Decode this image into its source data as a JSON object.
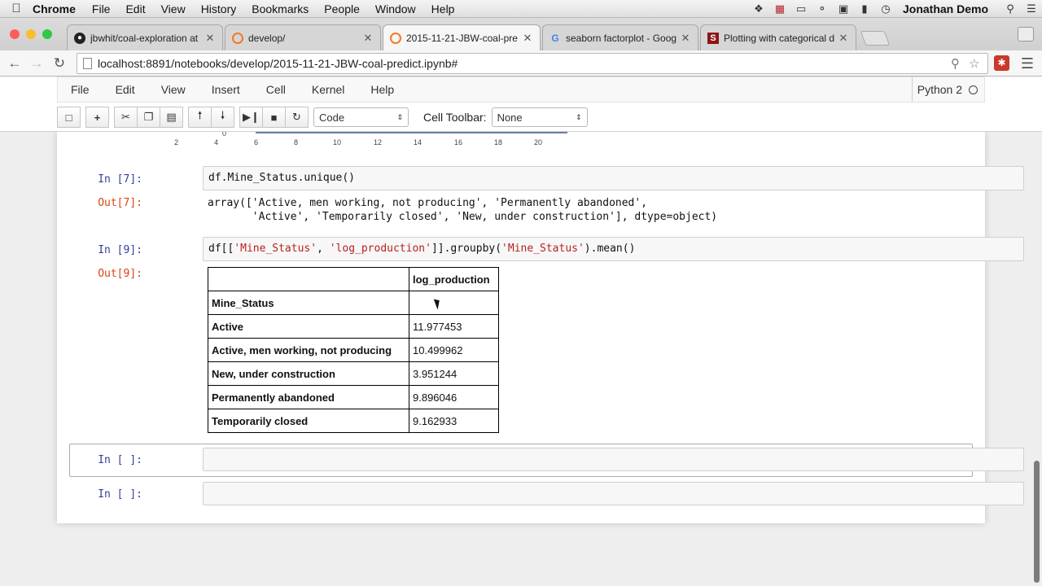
{
  "menubar": {
    "app": "Chrome",
    "items": [
      "File",
      "Edit",
      "View",
      "History",
      "Bookmarks",
      "People",
      "Window",
      "Help"
    ],
    "user": "Jonathan Demo"
  },
  "tabs": [
    {
      "title": "jbwhit/coal-exploration at",
      "icon": "github-icon"
    },
    {
      "title": "develop/",
      "icon": "jupyter-icon"
    },
    {
      "title": "2015-11-21-JBW-coal-pre",
      "icon": "jupyter-icon"
    },
    {
      "title": "seaborn factorplot - Goog",
      "icon": "google-icon"
    },
    {
      "title": "Plotting with categorical d",
      "icon": "stanford-icon"
    }
  ],
  "address_bar": {
    "url": "localhost:8891/notebooks/develop/2015-11-21-JBW-coal-predict.ipynb#"
  },
  "jupyter": {
    "menu": [
      "File",
      "Edit",
      "View",
      "Insert",
      "Cell",
      "Kernel",
      "Help"
    ],
    "kernel": "Python 2",
    "cell_type": "Code",
    "cell_toolbar_label": "Cell Toolbar:",
    "cell_toolbar_value": "None"
  },
  "plot_axis": {
    "ticks": [
      "0",
      "2",
      "4",
      "6",
      "8",
      "10",
      "12",
      "14",
      "16",
      "18",
      "20"
    ]
  },
  "cells": {
    "c7": {
      "in_prompt": "In [7]:",
      "code": "df.Mine_Status.unique()",
      "out_prompt": "Out[7]:",
      "output_line1": "array(['Active, men working, not producing', 'Permanently abandoned',",
      "output_line2": "       'Active', 'Temporarily closed', 'New, under construction'], dtype=object)"
    },
    "c9": {
      "in_prompt": "In [9]:",
      "code_a": "df[[",
      "code_s1": "'Mine_Status'",
      "code_b": ", ",
      "code_s2": "'log_production'",
      "code_c": "]].groupby(",
      "code_s3": "'Mine_Status'",
      "code_d": ").mean()",
      "out_prompt": "Out[9]:"
    },
    "empty1": {
      "in_prompt": "In [ ]:"
    },
    "empty2": {
      "in_prompt": "In [ ]:"
    }
  },
  "dataframe": {
    "column": "log_production",
    "index_name": "Mine_Status",
    "rows": [
      {
        "label": "Active",
        "value": "11.977453"
      },
      {
        "label": "Active, men working, not producing",
        "value": "10.499962"
      },
      {
        "label": "New, under construction",
        "value": "3.951244"
      },
      {
        "label": "Permanently abandoned",
        "value": "9.896046"
      },
      {
        "label": "Temporarily closed",
        "value": "9.162933"
      }
    ]
  }
}
